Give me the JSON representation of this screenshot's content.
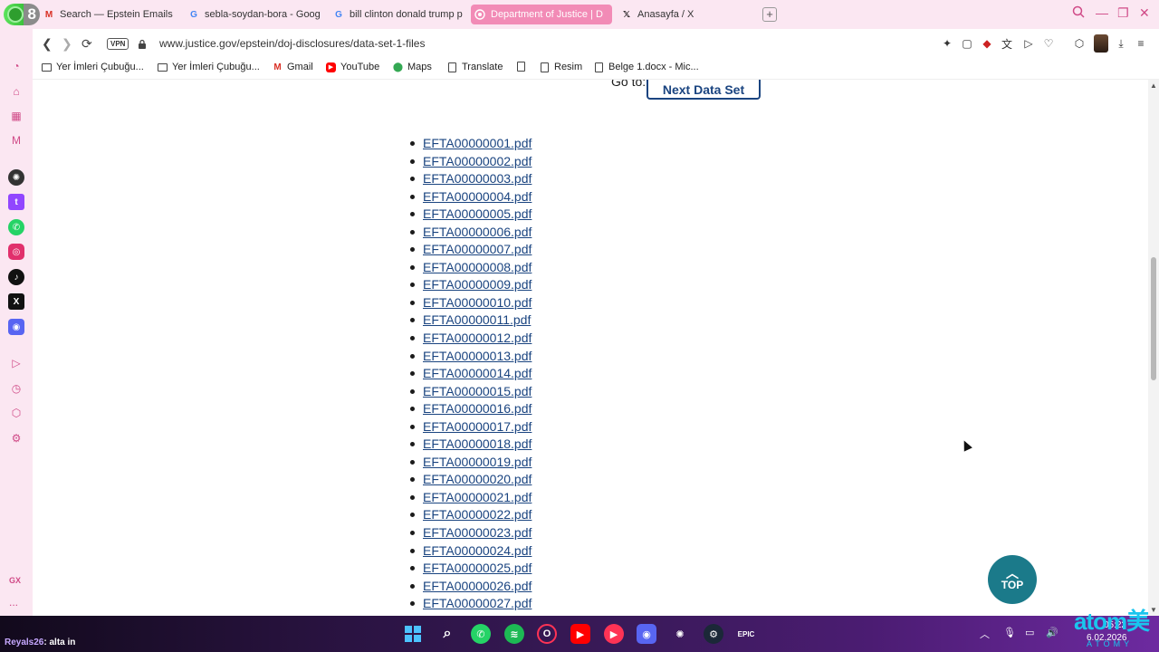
{
  "browser": {
    "badge_number": "8",
    "tabs": [
      {
        "title": "Search — Epstein Emails",
        "icon": "gmail-icon"
      },
      {
        "title": "sebla-soydan-bora - Goog",
        "icon": "google-icon"
      },
      {
        "title": "bill clinton donald trump p",
        "icon": "google-icon"
      },
      {
        "title": "Department of Justice | D",
        "icon": "doj-icon",
        "active": true
      },
      {
        "title": "Anasayfa / X",
        "icon": "x-icon"
      }
    ],
    "new_tab_label": "+",
    "vpn_label": "VPN",
    "url": "www.justice.gov/epstein/doj-disclosures/data-set-1-files",
    "accent_color": "#f28bb6"
  },
  "bookmarks": [
    {
      "label": "Yer İmleri Çubuğu...",
      "icon": "folder-icon"
    },
    {
      "label": "Yer İmleri Çubuğu...",
      "icon": "folder-icon"
    },
    {
      "label": "Gmail",
      "icon": "gmail-icon"
    },
    {
      "label": "YouTube",
      "icon": "youtube-icon"
    },
    {
      "label": "Maps",
      "icon": "maps-icon"
    },
    {
      "label": "Translate",
      "icon": "document-icon"
    },
    {
      "label": "",
      "icon": "document-icon"
    },
    {
      "label": "Resim",
      "icon": "document-icon"
    },
    {
      "label": "Belge 1.docx - Mic...",
      "icon": "document-icon"
    }
  ],
  "sidebar": {
    "gx_label": "GX",
    "more_label": "..."
  },
  "page": {
    "goto_label": "Go to:",
    "next_button_label": "Next Data Set",
    "files": [
      "EFTA00000001.pdf",
      "EFTA00000002.pdf",
      "EFTA00000003.pdf",
      "EFTA00000004.pdf",
      "EFTA00000005.pdf",
      "EFTA00000006.pdf",
      "EFTA00000007.pdf",
      "EFTA00000008.pdf",
      "EFTA00000009.pdf",
      "EFTA00000010.pdf",
      "EFTA00000011.pdf",
      "EFTA00000012.pdf",
      "EFTA00000013.pdf",
      "EFTA00000014.pdf",
      "EFTA00000015.pdf",
      "EFTA00000016.pdf",
      "EFTA00000017.pdf",
      "EFTA00000018.pdf",
      "EFTA00000019.pdf",
      "EFTA00000020.pdf",
      "EFTA00000021.pdf",
      "EFTA00000022.pdf",
      "EFTA00000023.pdf",
      "EFTA00000024.pdf",
      "EFTA00000025.pdf",
      "EFTA00000026.pdf",
      "EFTA00000027.pdf"
    ],
    "top_button_label": "TOP",
    "link_color": "#1a4480",
    "top_button_color": "#1b7a8a"
  },
  "taskbar": {
    "chat_user": "Reyals26",
    "chat_message": ": alta in",
    "time": "05:22",
    "date": "6.02.2026"
  },
  "watermark": {
    "brand": "atom美",
    "sub": "ATOMY"
  }
}
